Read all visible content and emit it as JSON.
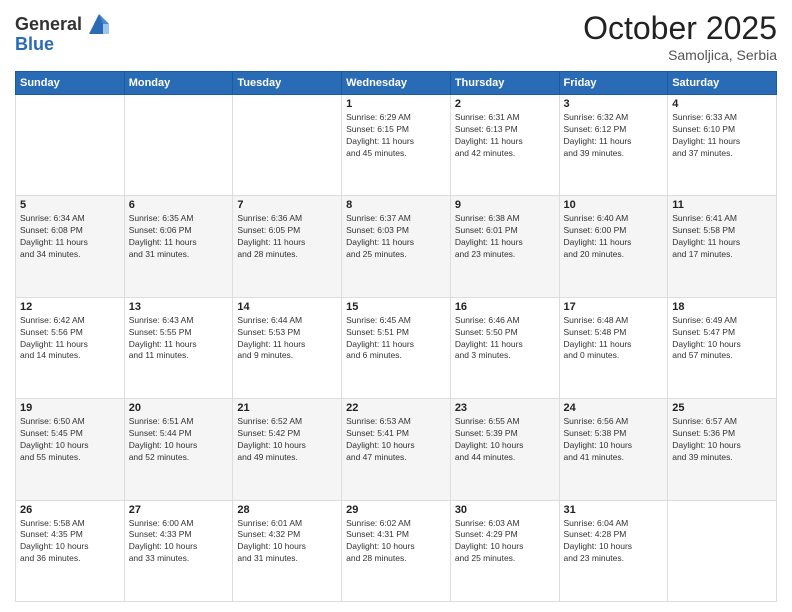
{
  "header": {
    "logo_general": "General",
    "logo_blue": "Blue",
    "month": "October 2025",
    "location": "Samoljica, Serbia"
  },
  "weekdays": [
    "Sunday",
    "Monday",
    "Tuesday",
    "Wednesday",
    "Thursday",
    "Friday",
    "Saturday"
  ],
  "weeks": [
    [
      {
        "day": "",
        "info": ""
      },
      {
        "day": "",
        "info": ""
      },
      {
        "day": "",
        "info": ""
      },
      {
        "day": "1",
        "info": "Sunrise: 6:29 AM\nSunset: 6:15 PM\nDaylight: 11 hours\nand 45 minutes."
      },
      {
        "day": "2",
        "info": "Sunrise: 6:31 AM\nSunset: 6:13 PM\nDaylight: 11 hours\nand 42 minutes."
      },
      {
        "day": "3",
        "info": "Sunrise: 6:32 AM\nSunset: 6:12 PM\nDaylight: 11 hours\nand 39 minutes."
      },
      {
        "day": "4",
        "info": "Sunrise: 6:33 AM\nSunset: 6:10 PM\nDaylight: 11 hours\nand 37 minutes."
      }
    ],
    [
      {
        "day": "5",
        "info": "Sunrise: 6:34 AM\nSunset: 6:08 PM\nDaylight: 11 hours\nand 34 minutes."
      },
      {
        "day": "6",
        "info": "Sunrise: 6:35 AM\nSunset: 6:06 PM\nDaylight: 11 hours\nand 31 minutes."
      },
      {
        "day": "7",
        "info": "Sunrise: 6:36 AM\nSunset: 6:05 PM\nDaylight: 11 hours\nand 28 minutes."
      },
      {
        "day": "8",
        "info": "Sunrise: 6:37 AM\nSunset: 6:03 PM\nDaylight: 11 hours\nand 25 minutes."
      },
      {
        "day": "9",
        "info": "Sunrise: 6:38 AM\nSunset: 6:01 PM\nDaylight: 11 hours\nand 23 minutes."
      },
      {
        "day": "10",
        "info": "Sunrise: 6:40 AM\nSunset: 6:00 PM\nDaylight: 11 hours\nand 20 minutes."
      },
      {
        "day": "11",
        "info": "Sunrise: 6:41 AM\nSunset: 5:58 PM\nDaylight: 11 hours\nand 17 minutes."
      }
    ],
    [
      {
        "day": "12",
        "info": "Sunrise: 6:42 AM\nSunset: 5:56 PM\nDaylight: 11 hours\nand 14 minutes."
      },
      {
        "day": "13",
        "info": "Sunrise: 6:43 AM\nSunset: 5:55 PM\nDaylight: 11 hours\nand 11 minutes."
      },
      {
        "day": "14",
        "info": "Sunrise: 6:44 AM\nSunset: 5:53 PM\nDaylight: 11 hours\nand 9 minutes."
      },
      {
        "day": "15",
        "info": "Sunrise: 6:45 AM\nSunset: 5:51 PM\nDaylight: 11 hours\nand 6 minutes."
      },
      {
        "day": "16",
        "info": "Sunrise: 6:46 AM\nSunset: 5:50 PM\nDaylight: 11 hours\nand 3 minutes."
      },
      {
        "day": "17",
        "info": "Sunrise: 6:48 AM\nSunset: 5:48 PM\nDaylight: 11 hours\nand 0 minutes."
      },
      {
        "day": "18",
        "info": "Sunrise: 6:49 AM\nSunset: 5:47 PM\nDaylight: 10 hours\nand 57 minutes."
      }
    ],
    [
      {
        "day": "19",
        "info": "Sunrise: 6:50 AM\nSunset: 5:45 PM\nDaylight: 10 hours\nand 55 minutes."
      },
      {
        "day": "20",
        "info": "Sunrise: 6:51 AM\nSunset: 5:44 PM\nDaylight: 10 hours\nand 52 minutes."
      },
      {
        "day": "21",
        "info": "Sunrise: 6:52 AM\nSunset: 5:42 PM\nDaylight: 10 hours\nand 49 minutes."
      },
      {
        "day": "22",
        "info": "Sunrise: 6:53 AM\nSunset: 5:41 PM\nDaylight: 10 hours\nand 47 minutes."
      },
      {
        "day": "23",
        "info": "Sunrise: 6:55 AM\nSunset: 5:39 PM\nDaylight: 10 hours\nand 44 minutes."
      },
      {
        "day": "24",
        "info": "Sunrise: 6:56 AM\nSunset: 5:38 PM\nDaylight: 10 hours\nand 41 minutes."
      },
      {
        "day": "25",
        "info": "Sunrise: 6:57 AM\nSunset: 5:36 PM\nDaylight: 10 hours\nand 39 minutes."
      }
    ],
    [
      {
        "day": "26",
        "info": "Sunrise: 5:58 AM\nSunset: 4:35 PM\nDaylight: 10 hours\nand 36 minutes."
      },
      {
        "day": "27",
        "info": "Sunrise: 6:00 AM\nSunset: 4:33 PM\nDaylight: 10 hours\nand 33 minutes."
      },
      {
        "day": "28",
        "info": "Sunrise: 6:01 AM\nSunset: 4:32 PM\nDaylight: 10 hours\nand 31 minutes."
      },
      {
        "day": "29",
        "info": "Sunrise: 6:02 AM\nSunset: 4:31 PM\nDaylight: 10 hours\nand 28 minutes."
      },
      {
        "day": "30",
        "info": "Sunrise: 6:03 AM\nSunset: 4:29 PM\nDaylight: 10 hours\nand 25 minutes."
      },
      {
        "day": "31",
        "info": "Sunrise: 6:04 AM\nSunset: 4:28 PM\nDaylight: 10 hours\nand 23 minutes."
      },
      {
        "day": "",
        "info": ""
      }
    ]
  ]
}
